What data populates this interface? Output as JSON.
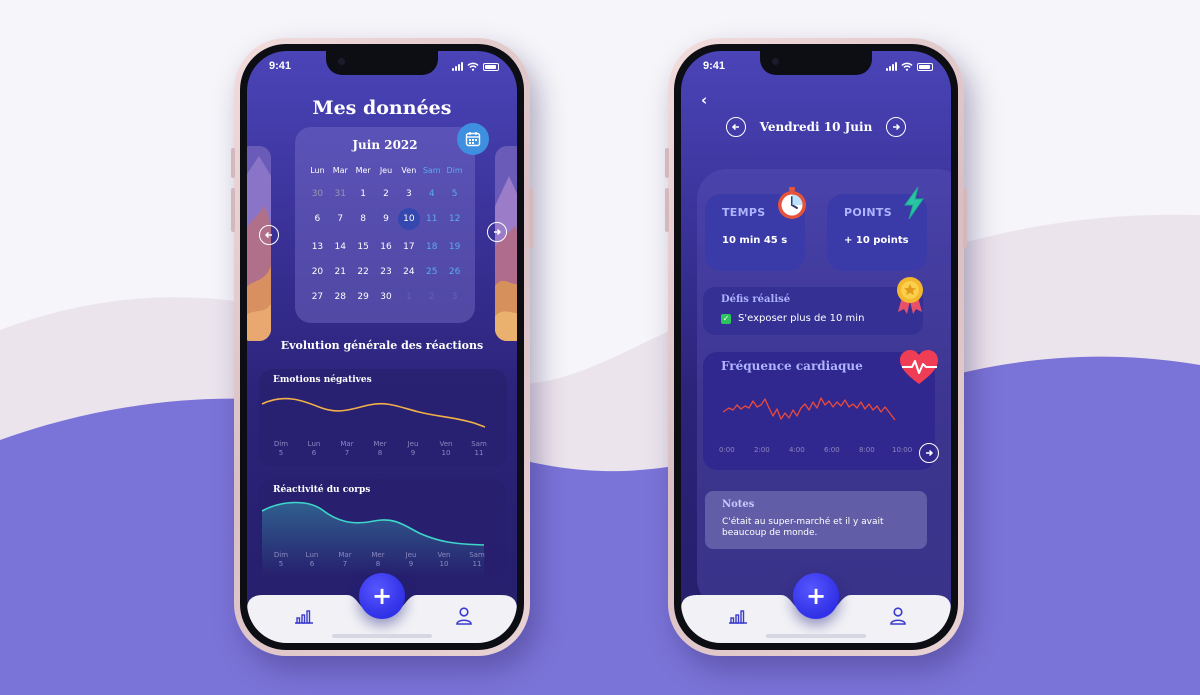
{
  "status": {
    "time": "9:41"
  },
  "screen1": {
    "title": "Mes données",
    "calendar": {
      "month": "Juin 2022",
      "weekdays": [
        "Lun",
        "Mar",
        "Mer",
        "Jeu",
        "Ven",
        "Sam",
        "Dim"
      ],
      "weeks": [
        [
          "30",
          "31",
          "1",
          "2",
          "3",
          "4",
          "5"
        ],
        [
          "6",
          "7",
          "8",
          "9",
          "10",
          "11",
          "12"
        ],
        [
          "13",
          "14",
          "15",
          "16",
          "17",
          "18",
          "19"
        ],
        [
          "20",
          "21",
          "22",
          "23",
          "24",
          "25",
          "26"
        ],
        [
          "27",
          "28",
          "29",
          "30",
          "1",
          "2",
          "3"
        ]
      ],
      "selected": "10"
    },
    "section_title": "Evolution générale des réactions",
    "charts": [
      {
        "title": "Emotions négatives",
        "color": "#f2b04a",
        "x_labels": [
          [
            "Dim",
            "5"
          ],
          [
            "Lun",
            "6"
          ],
          [
            "Mar",
            "7"
          ],
          [
            "Mer",
            "8"
          ],
          [
            "Jeu",
            "9"
          ],
          [
            "Ven",
            "10"
          ],
          [
            "Sam",
            "11"
          ]
        ]
      },
      {
        "title": "Réactivité du corps",
        "color": "#3dd6c8",
        "x_labels": [
          [
            "Dim",
            "5"
          ],
          [
            "Lun",
            "6"
          ],
          [
            "Mar",
            "7"
          ],
          [
            "Mer",
            "8"
          ],
          [
            "Jeu",
            "9"
          ],
          [
            "Ven",
            "10"
          ],
          [
            "Sam",
            "11"
          ]
        ]
      }
    ],
    "fab": "+"
  },
  "screen2": {
    "back": "‹",
    "date": "Vendredi 10 Juin",
    "temps": {
      "label": "TEMPS",
      "value": "10 min 45 s"
    },
    "points": {
      "label": "POINTS",
      "value": "+ 10 points"
    },
    "defis": {
      "label": "Défis réalisé",
      "item": "S'exposer plus de 10 min"
    },
    "heart": {
      "label": "Fréquence cardiaque",
      "x_labels": [
        "0:00",
        "2:00",
        "4:00",
        "6:00",
        "8:00",
        "10:00"
      ]
    },
    "notes": {
      "label": "Notes",
      "text": "C'était au super-marché et il y avait beaucoup de monde."
    },
    "fab": "+"
  },
  "colors": {
    "background_wave": "#7b74d8",
    "accent_fab": "#3434e8",
    "label_blue": "#aeb4ff"
  }
}
